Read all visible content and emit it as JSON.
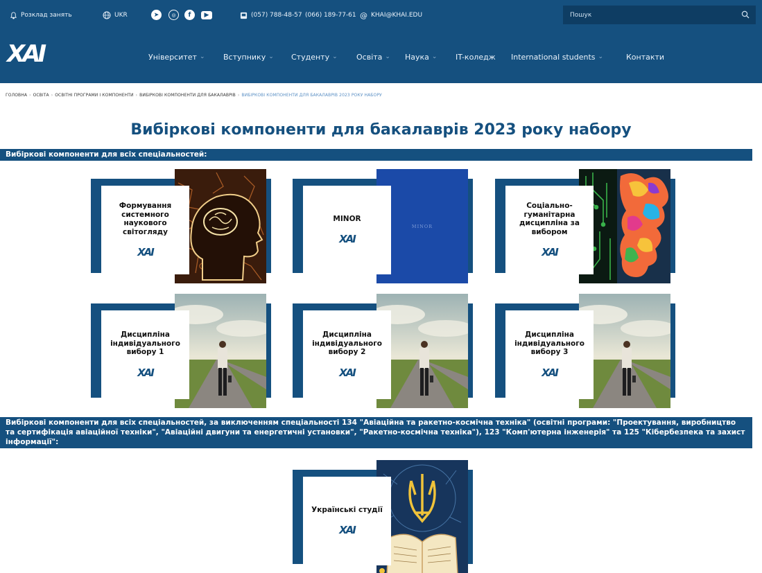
{
  "topbar": {
    "schedule": "Розклад занять",
    "lang": "UKR",
    "phone1": "(057) 788-48-57",
    "phone2": "(066) 189-77-61",
    "email": "KHAI@KHAI.EDU",
    "search_placeholder": "Пошук",
    "social": [
      "telegram-icon",
      "instagram-icon",
      "facebook-icon",
      "youtube-icon"
    ]
  },
  "nav": {
    "logo": "ХАІ",
    "items": [
      "Університет",
      "Вступнику",
      "Студенту",
      "Освіта",
      "Наука",
      "IT-коледж",
      "International students",
      "Контакти"
    ]
  },
  "breadcrumb": [
    "ГОЛОВНА",
    "ОСВІТА",
    "ОСВІТНІ ПРОГРАМИ І КОМПОНЕНТИ",
    "ВИБІРКОВІ КОМПОНЕНТИ ДЛЯ БАКАЛАВРІВ",
    "ВИБІРКОВІ КОМПОНЕНТИ ДЛЯ БАКАЛАВРІВ 2023 РОКУ НАБОРУ"
  ],
  "page": {
    "title": "Вибіркові компоненти для бакалаврів 2023 року набору",
    "section1": "Вибіркові компоненти для всіх спеціальностей:",
    "section2": "Вибіркові компоненти для всіх спеціальностей, за виключенням спеціальності 134 \"Авіаційна та ракетно-космічна техніка\" (освітні програми: \"Проектування, виробництво та сертифікація авіаційної техніки\", \"Авіаційні двигуни та енергетичні установки\", \"Ракетно-космічна техніка\"), 123 \"Комп'ютерна інженерія\" та 125 \"Кібербезпека та захист інформації\":"
  },
  "cards": [
    {
      "title": "Формування системного наукового світогляду",
      "logo": "ХАІ"
    },
    {
      "title": "MINOR",
      "logo": "ХАІ",
      "art_text": "MINOR"
    },
    {
      "title": "Соціально-гуманітарна дисципліна за вибором",
      "logo": "ХАІ"
    },
    {
      "title": "Дисципліна індивідуального вибору 1",
      "logo": "ХАІ"
    },
    {
      "title": "Дисципліна індивідуального вибору 2",
      "logo": "ХАІ"
    },
    {
      "title": "Дисципліна індивідуального вибору 3",
      "logo": "ХАІ"
    },
    {
      "title": "Українські студії",
      "logo": "ХАІ"
    }
  ],
  "colors": {
    "brand": "#15507f",
    "accent": "#4b8ccb",
    "art_minor": "#1b4aa8"
  }
}
